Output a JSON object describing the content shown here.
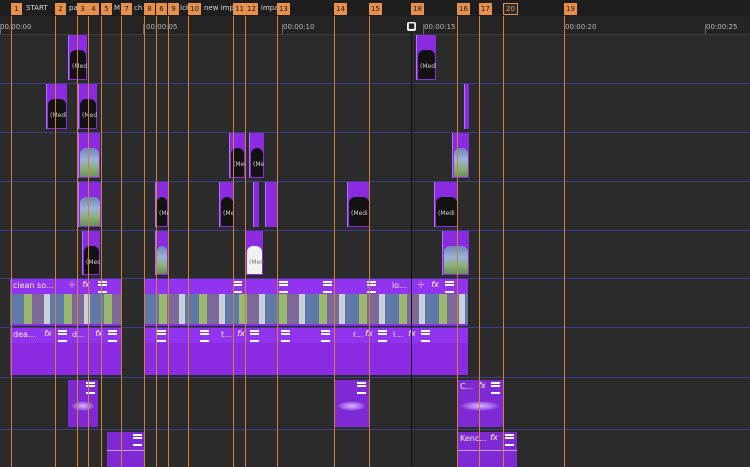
{
  "markers": [
    {
      "num": "1",
      "name": "START"
    },
    {
      "num": "2",
      "name": "pa"
    },
    {
      "num": "3",
      "name": ""
    },
    {
      "num": "4",
      "name": ""
    },
    {
      "num": "5",
      "name": "M"
    },
    {
      "num": "7",
      "name": "ch"
    },
    {
      "num": "8",
      "name": ""
    },
    {
      "num": "6",
      "name": ""
    },
    {
      "num": "9",
      "name": "Ick"
    },
    {
      "num": "10",
      "name": "new imp"
    },
    {
      "num": "11",
      "name": ""
    },
    {
      "num": "12",
      "name": "impac"
    },
    {
      "num": "13",
      "name": ""
    },
    {
      "num": "14",
      "name": ""
    },
    {
      "num": "15",
      "name": ""
    },
    {
      "num": "18",
      "name": ""
    },
    {
      "num": "16",
      "name": ""
    },
    {
      "num": "17",
      "name": ""
    },
    {
      "num": "20",
      "name": ""
    },
    {
      "num": "19",
      "name": ""
    }
  ],
  "ruler": {
    "labels": [
      "00:00:00",
      "00:00:05",
      "00:00:10",
      "00:00:15",
      "00:00:20",
      "00:00:25"
    ]
  },
  "clip_placeholder": "(Medi",
  "wide_clips": {
    "video_a": {
      "label1": "clean so...",
      "label2": "lo..."
    },
    "video_b": {
      "label1": "dea...",
      "label2": "d...",
      "label3": "t...",
      "label4": "r...",
      "label5": "l..."
    }
  },
  "audio_clips": {
    "c1": "C...",
    "c2": "Kenc..."
  },
  "icons": {
    "fx": "fx",
    "crop": "⊹",
    "menu": "menu-icon"
  },
  "colors": {
    "clip": "#8a2be2",
    "marker": "#e8904a",
    "background": "#2b2b2b"
  }
}
